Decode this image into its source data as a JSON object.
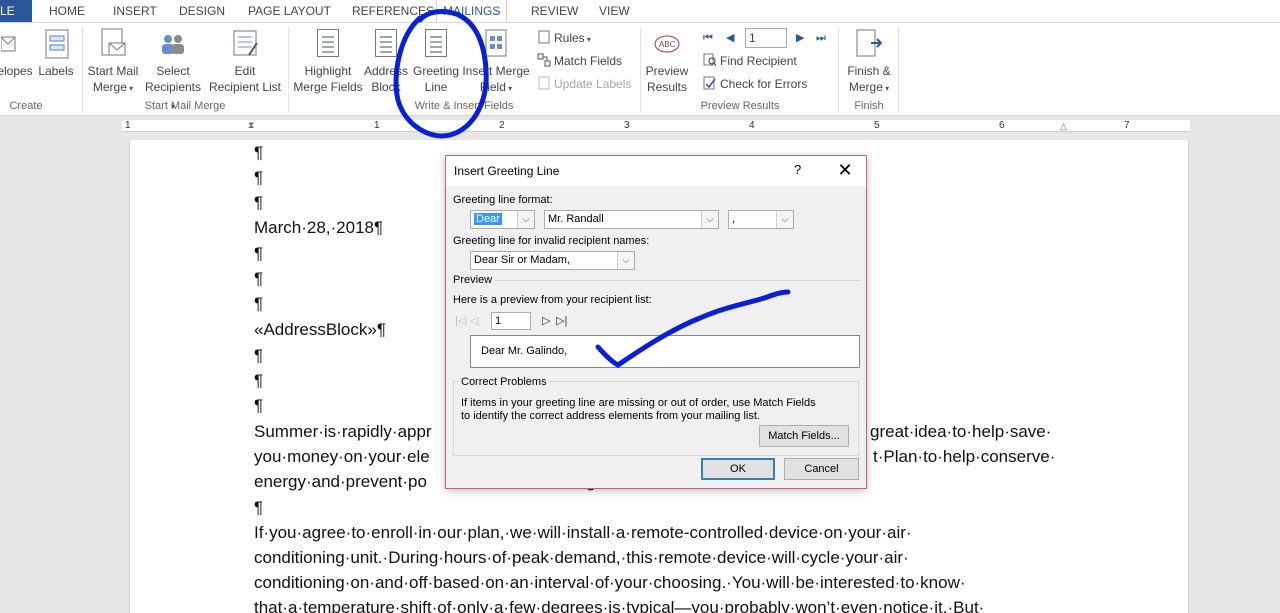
{
  "tabs": {
    "file": "LE",
    "home": "HOME",
    "insert": "INSERT",
    "design": "DESIGN",
    "page_layout": "PAGE LAYOUT",
    "references": "REFERENCES",
    "mailings": "MAILINGS",
    "review": "REVIEW",
    "view": "VIEW"
  },
  "ribbon": {
    "create": {
      "envelopes": "elopes",
      "labels": "Labels",
      "group": "Create"
    },
    "start_mail_merge": {
      "start_l1": "Start Mail",
      "start_l2": "Merge",
      "select_l1": "Select",
      "select_l2": "Recipients",
      "edit_l1": "Edit",
      "edit_l2": "Recipient List",
      "group": "Start Mail Merge"
    },
    "write_insert": {
      "highlight_l1": "Highlight",
      "highlight_l2": "Merge Fields",
      "address_l1": "Address",
      "address_l2": "Block",
      "greeting_l1": "Greeting",
      "greeting_l2": "Line",
      "insert_l1": "Insert Merge",
      "insert_l2": "Field",
      "rules": "Rules",
      "match_fields": "Match Fields",
      "update_labels": "Update Labels",
      "group": "Write & Insert Fields"
    },
    "preview": {
      "preview_l1": "Preview",
      "preview_l2": "Results",
      "record": "1",
      "find_recipient": "Find Recipient",
      "check_errors": "Check for Errors",
      "group": "Preview Results"
    },
    "finish": {
      "finish_l1": "Finish &",
      "finish_l2": "Merge",
      "group": "Finish"
    }
  },
  "ruler": {
    "marks": [
      "1",
      "1",
      "2",
      "3",
      "4",
      "5",
      "6",
      "7"
    ]
  },
  "document": {
    "lines": [
      "¶",
      "¶",
      "¶",
      "March·28,·2018¶",
      "¶",
      "¶",
      "¶",
      "«AddressBlock»¶",
      "¶",
      "¶",
      "¶",
      "Summer·is·rapidly·appr",
      "you·money·on·your·ele",
      "energy·and·prevent·po",
      "¶",
      "If·you·agree·to·enroll·in·our·plan,·we·will·install·a·remote-controlled·device·on·your·air·",
      "conditioning·unit.·During·hours·of·peak·demand,·this·remote·device·will·cycle·your·air·",
      "conditioning·on·and·off·based·on·an·interval·of·your·choosing.·You·will·be·interested·to·know·",
      "that·a·temperature·shift·of·only·a·few·degrees·is·typical—you·probably·won’t·even·notice·it.·But·"
    ],
    "right_fragments": {
      "line12": "great·idea·to·help·save·",
      "line13": "t·Plan·to·help·conserve·",
      "line14": "g"
    }
  },
  "dialog": {
    "title": "Insert Greeting Line",
    "help": "?",
    "close": "✕",
    "format_label": "Greeting line format:",
    "salutation": "Dear",
    "name_format": "Mr. Randall",
    "punctuation": ",",
    "invalid_label": "Greeting line for invalid recipient names:",
    "invalid_value": "Dear Sir or Madam,",
    "preview_section": "Preview",
    "preview_desc": "Here is a preview from your recipient list:",
    "record_value": "1",
    "preview_text": "Dear Mr. Galindo,",
    "correct_section": "Correct Problems",
    "correct_line1": "If items in your greeting line are missing or out of order, use Match Fields",
    "correct_line2": "to identify the correct address elements from your mailing list.",
    "match_fields_btn": "Match Fields...",
    "ok_btn": "OK",
    "cancel_btn": "Cancel"
  },
  "colors": {
    "file_tab": "#2b579a",
    "accent": "#2b579a",
    "annotation_blue": "#0a1fd6",
    "dialog_border": "#c0608a"
  }
}
